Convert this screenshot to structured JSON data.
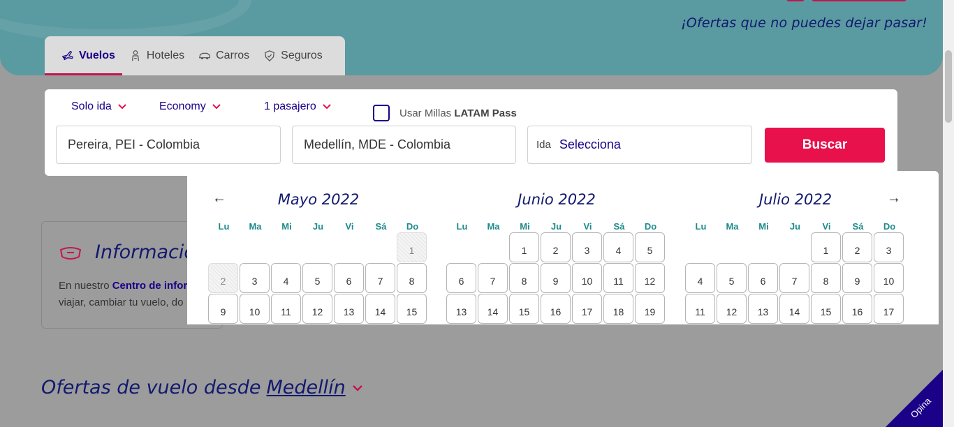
{
  "hero": {
    "promo_text": "¡Ofertas que no puedes dejar pasar!"
  },
  "tabs": [
    {
      "label": "Vuelos",
      "icon": "plane-icon",
      "active": true
    },
    {
      "label": "Hoteles",
      "icon": "bellhop-icon",
      "active": false
    },
    {
      "label": "Carros",
      "icon": "car-icon",
      "active": false
    },
    {
      "label": "Seguros",
      "icon": "shield-icon",
      "active": false
    }
  ],
  "search": {
    "trip_type": "Solo ida",
    "cabin": "Economy",
    "passengers": "1 pasajero",
    "millas_prefix": "Usar Millas",
    "millas_brand": "LATAM Pass",
    "origin": "Pereira, PEI - Colombia",
    "destination": "Medellín, MDE - Colombia",
    "date_label": "Ida",
    "date_placeholder": "Selecciona",
    "submit": "Buscar"
  },
  "calendar": {
    "weekdays": [
      "Lu",
      "Ma",
      "Mi",
      "Ju",
      "Vi",
      "Sá",
      "Do"
    ],
    "months": [
      {
        "title": "Mayo 2022",
        "offset": 6,
        "days": [
          "1",
          "2",
          "3",
          "4",
          "5",
          "6",
          "7",
          "8",
          "9",
          "10",
          "11",
          "12",
          "13",
          "14",
          "15"
        ],
        "disabled": [
          "1",
          "2"
        ]
      },
      {
        "title": "Junio 2022",
        "offset": 2,
        "days": [
          "1",
          "2",
          "3",
          "4",
          "5",
          "6",
          "7",
          "8",
          "9",
          "10",
          "11",
          "12",
          "13",
          "14",
          "15",
          "16",
          "17",
          "18",
          "19"
        ],
        "disabled": []
      },
      {
        "title": "Julio 2022",
        "offset": 4,
        "days": [
          "1",
          "2",
          "3",
          "4",
          "5",
          "6",
          "7",
          "8",
          "9",
          "10",
          "11",
          "12",
          "13",
          "14",
          "15",
          "16",
          "17"
        ],
        "disabled": []
      }
    ],
    "prev_arrow": "←",
    "next_arrow": "→"
  },
  "info": {
    "title": "Información",
    "line1_prefix": "En nuestro",
    "line1_link": "Centro de infor",
    "line2": "viajar, cambiar tu vuelo, do"
  },
  "offers": {
    "prefix": "Ofertas de vuelo desde",
    "city": "Medellín"
  },
  "feedback": {
    "label": "Opina"
  },
  "colors": {
    "brand_pink": "#e8114b",
    "brand_navy": "#1b0088",
    "teal": "#5a9aa1"
  }
}
